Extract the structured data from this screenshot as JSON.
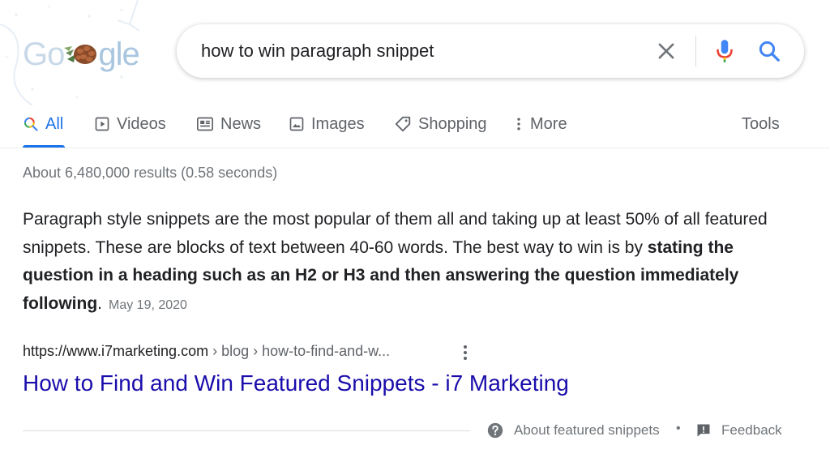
{
  "logo": {
    "letters_left": "Go",
    "letters_right": "gle",
    "pinecone_icon": "pinecone-icon"
  },
  "search": {
    "query": "how to win paragraph snippet",
    "clear_icon": "close-icon",
    "mic_icon": "microphone-icon",
    "search_icon": "search-icon"
  },
  "tabs": [
    {
      "label": "All",
      "icon": "search-icon",
      "active": true
    },
    {
      "label": "Videos",
      "icon": "play-icon"
    },
    {
      "label": "News",
      "icon": "newspaper-icon"
    },
    {
      "label": "Images",
      "icon": "image-icon"
    },
    {
      "label": "Shopping",
      "icon": "tag-icon"
    },
    {
      "label": "More",
      "icon": "kebab-icon"
    }
  ],
  "tools_label": "Tools",
  "result_stats": "About 6,480,000 results (0.58 seconds)",
  "snippet": {
    "text_plain": "Paragraph style snippets are the most popular of them all and taking up at least 50% of all featured snippets. These are blocks of text between 40-60 words. The best way to win is by ",
    "text_bold": "stating the question in a heading such as an H2 or H3 and then answering the question immediately following",
    "text_end": ".",
    "date": "May 19, 2020"
  },
  "result": {
    "url_domain": "https://www.i7marketing.com",
    "url_crumbs": " › blog › how-to-find-and-w...",
    "title": "How to Find and Win Featured Snippets - i7 Marketing"
  },
  "footer": {
    "about_label": "About featured snippets",
    "separator": "•",
    "feedback_label": "Feedback"
  },
  "colors": {
    "accent": "#1a73e8",
    "link": "#1a0dab",
    "muted": "#70757a"
  }
}
